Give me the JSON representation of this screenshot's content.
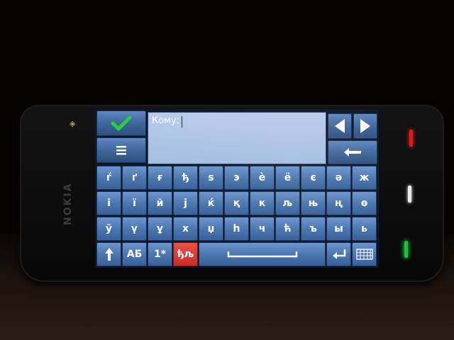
{
  "device": {
    "brand": "NOKIA"
  },
  "compose": {
    "to_label": "Кому:",
    "to_value": ""
  },
  "toolbar": {
    "accept_icon": "check-icon",
    "menu_icon": "menu-icon",
    "left_icon": "arrow-left-icon",
    "right_icon": "arrow-right-icon",
    "backspace_icon": "backspace-icon"
  },
  "keyboard": {
    "rows": [
      [
        "ѓ",
        "ґ",
        "ғ",
        "ђ",
        "ѕ",
        "э",
        "è",
        "ё",
        "є",
        "ә",
        "ж"
      ],
      [
        "і",
        "ї",
        "й",
        "ј",
        "ќ",
        "қ",
        "к",
        "љ",
        "њ",
        "ң",
        "ө"
      ],
      [
        "ў",
        "ү",
        "ұ",
        "х",
        "џ",
        "һ",
        "ч",
        "ћ",
        "ъ",
        "ы",
        "ь"
      ]
    ],
    "bottom": {
      "shift_icon": "shift-arrow-icon",
      "case_label": "АБ",
      "numbers_label": "1*",
      "special_label": "ђљ",
      "space_icon": "space-bar-icon",
      "enter_icon": "enter-icon",
      "layout_icon": "keyboard-icon"
    }
  },
  "indicators": {
    "colors": {
      "red": "#e01a1a",
      "white": "#e8e8e8",
      "green": "#18c23a",
      "accent": "#4874ad",
      "active_key": "#cc2c24"
    }
  }
}
